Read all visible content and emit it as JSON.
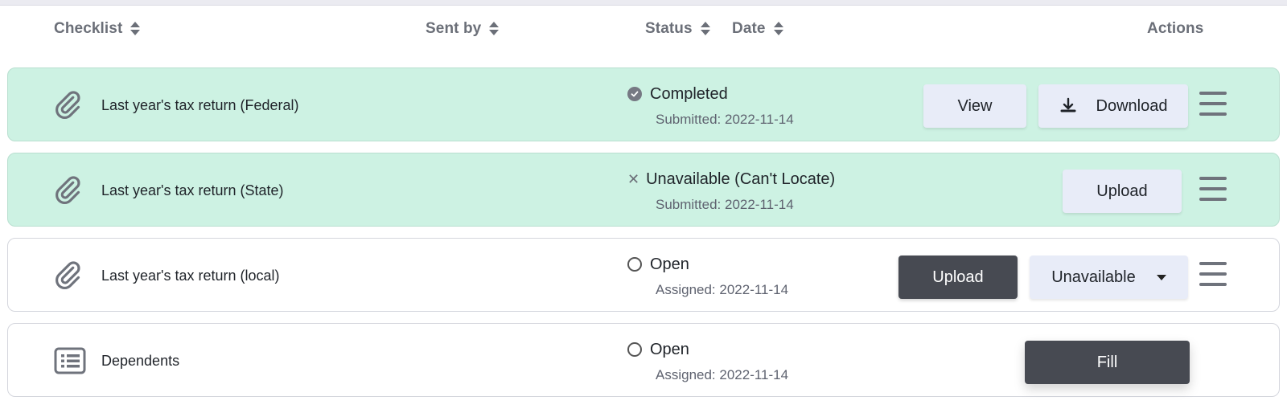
{
  "columns": {
    "checklist": "Checklist",
    "sent_by": "Sent by",
    "status": "Status",
    "date": "Date",
    "actions": "Actions"
  },
  "rows": [
    {
      "name": "Last year's tax return (Federal)",
      "icon": "paperclip-icon",
      "status": "Completed",
      "status_icon": "check-circle-icon",
      "sub": "Submitted: 2022-11-14",
      "completed": true,
      "actions": {
        "view": "View",
        "download": "Download"
      }
    },
    {
      "name": "Last year's tax return (State)",
      "icon": "paperclip-icon",
      "status": "Unavailable (Can't Locate)",
      "status_icon": "x-icon",
      "sub": "Submitted: 2022-11-14",
      "completed": true,
      "actions": {
        "upload": "Upload"
      }
    },
    {
      "name": "Last year's tax return (local)",
      "icon": "paperclip-icon",
      "status": "Open",
      "status_icon": "open-circle-icon",
      "sub": "Assigned: 2022-11-14",
      "completed": false,
      "actions": {
        "upload": "Upload",
        "unavailable": "Unavailable"
      }
    },
    {
      "name": "Dependents",
      "icon": "list-form-icon",
      "status": "Open",
      "status_icon": "open-circle-icon",
      "sub": "Assigned: 2022-11-14",
      "completed": false,
      "actions": {
        "fill": "Fill"
      }
    }
  ],
  "colors": {
    "completed_row_bg": "#cdf2e3",
    "light_button_bg": "#e8ecf8",
    "dark_button_bg": "#474a52",
    "header_text": "#6b6f78"
  }
}
